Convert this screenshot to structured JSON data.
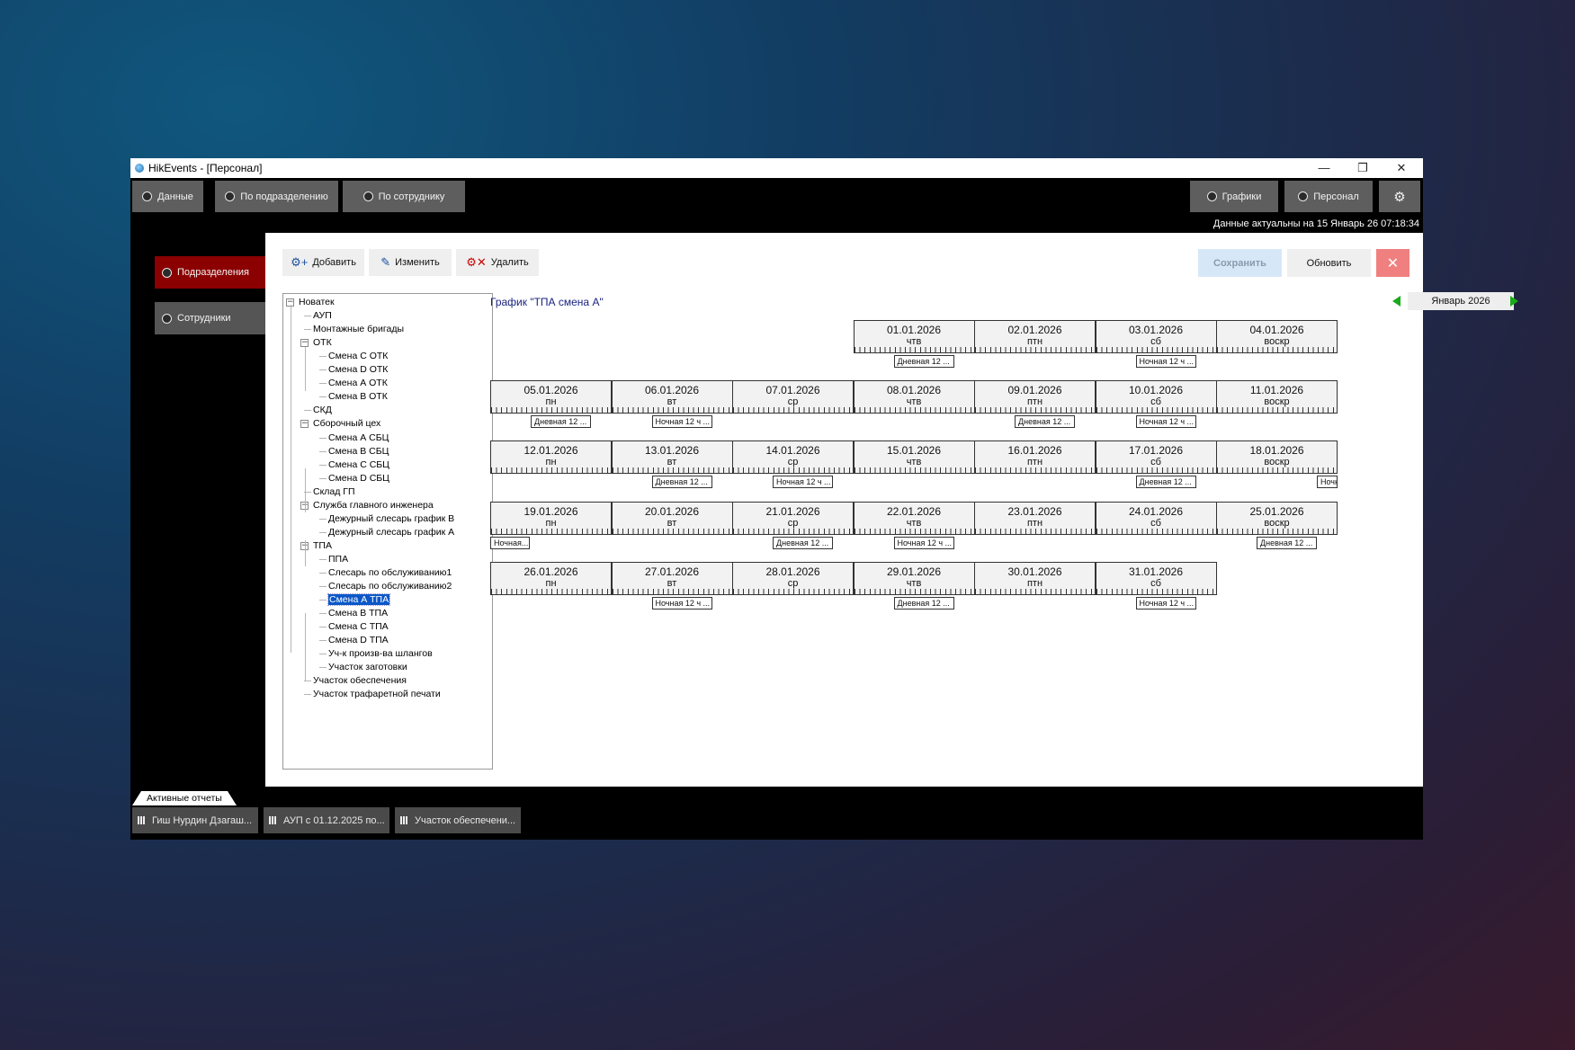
{
  "window": {
    "title": "HikEvents - [Персонал]",
    "minimize": "—",
    "maximize": "❐",
    "close": "✕"
  },
  "topnav": {
    "left": [
      "Данные",
      "По подразделению",
      "По сотруднику"
    ],
    "right": [
      "Графики",
      "Персонал"
    ],
    "settings_icon": "gear-icon"
  },
  "status": "Данные актуальны на 15 Январь 26 07:18:34",
  "sidebar": {
    "items": [
      "Подразделения",
      "Сотрудники"
    ],
    "active_color": "#8b0000"
  },
  "toolbar": {
    "add": "Добавить",
    "edit": "Изменить",
    "delete": "Удалить",
    "save": "Сохранить",
    "refresh": "Обновить"
  },
  "tree": [
    {
      "label": "Новатек",
      "level": 0,
      "exp": true
    },
    {
      "label": "АУП",
      "level": 1
    },
    {
      "label": "Монтажные бригады",
      "level": 1
    },
    {
      "label": "ОТК",
      "level": 1,
      "exp": true
    },
    {
      "label": "Смена С ОТК",
      "level": 2
    },
    {
      "label": "Смена D ОТК",
      "level": 2
    },
    {
      "label": "Смена А ОТК",
      "level": 2
    },
    {
      "label": "Смена В ОТК",
      "level": 2
    },
    {
      "label": "СКД",
      "level": 1
    },
    {
      "label": "Сборочный цех",
      "level": 1,
      "exp": true
    },
    {
      "label": "Смена А СБЦ",
      "level": 2
    },
    {
      "label": "Смена В СБЦ",
      "level": 2
    },
    {
      "label": "Смена С СБЦ",
      "level": 2
    },
    {
      "label": "Смена D СБЦ",
      "level": 2
    },
    {
      "label": "Склад ГП",
      "level": 1
    },
    {
      "label": "Служба главного инженера",
      "level": 1,
      "exp": true
    },
    {
      "label": "Дежурный слесарь график В",
      "level": 2
    },
    {
      "label": "Дежурный слесарь график А",
      "level": 2
    },
    {
      "label": "ТПА",
      "level": 1,
      "exp": true
    },
    {
      "label": "ППА",
      "level": 2
    },
    {
      "label": "Слесарь по обслуживанию1",
      "level": 2
    },
    {
      "label": "Слесарь по обслуживанию2",
      "level": 2
    },
    {
      "label": "Смена А ТПА",
      "level": 2,
      "selected": true
    },
    {
      "label": "Смена В ТПА",
      "level": 2
    },
    {
      "label": "Смена С ТПА",
      "level": 2
    },
    {
      "label": "Смена D ТПА",
      "level": 2
    },
    {
      "label": "Уч-к произв-ва шлангов",
      "level": 2
    },
    {
      "label": "Участок заготовки",
      "level": 2
    },
    {
      "label": "Участок обеспечения",
      "level": 1
    },
    {
      "label": "Участок трафаретной печати",
      "level": 1
    }
  ],
  "schedule": {
    "title": "График \"ТПА смена А\"",
    "month": "Январь 2026",
    "days": [
      {
        "date": "01.01.2026",
        "dow": "чтв",
        "shift": "Дневная 12 ..."
      },
      {
        "date": "02.01.2026",
        "dow": "птн",
        "shift": ""
      },
      {
        "date": "03.01.2026",
        "dow": "сб",
        "shift": "Ночная 12 ч ..."
      },
      {
        "date": "04.01.2026",
        "dow": "воскр",
        "shift": ""
      },
      {
        "date": "05.01.2026",
        "dow": "пн",
        "shift": "Дневная 12 ..."
      },
      {
        "date": "06.01.2026",
        "dow": "вт",
        "shift": "Ночная 12 ч ..."
      },
      {
        "date": "07.01.2026",
        "dow": "ср",
        "shift": ""
      },
      {
        "date": "08.01.2026",
        "dow": "чтв",
        "shift": ""
      },
      {
        "date": "09.01.2026",
        "dow": "птн",
        "shift": "Дневная 12 ..."
      },
      {
        "date": "10.01.2026",
        "dow": "сб",
        "shift": "Ночная 12 ч ..."
      },
      {
        "date": "11.01.2026",
        "dow": "воскр",
        "shift": ""
      },
      {
        "date": "12.01.2026",
        "dow": "пн",
        "shift": ""
      },
      {
        "date": "13.01.2026",
        "dow": "вт",
        "shift": "Дневная 12 ..."
      },
      {
        "date": "14.01.2026",
        "dow": "ср",
        "shift": "Ночная 12 ч ..."
      },
      {
        "date": "15.01.2026",
        "dow": "чтв",
        "shift": ""
      },
      {
        "date": "16.01.2026",
        "dow": "птн",
        "shift": ""
      },
      {
        "date": "17.01.2026",
        "dow": "сб",
        "shift": "Дневная 12 ..."
      },
      {
        "date": "18.01.2026",
        "dow": "воскр",
        "shift": "Ночн"
      },
      {
        "date": "19.01.2026",
        "dow": "пн",
        "shift": "Ночная..."
      },
      {
        "date": "20.01.2026",
        "dow": "вт",
        "shift": ""
      },
      {
        "date": "21.01.2026",
        "dow": "ср",
        "shift": "Дневная 12 ..."
      },
      {
        "date": "22.01.2026",
        "dow": "чтв",
        "shift": "Ночная 12 ч ..."
      },
      {
        "date": "23.01.2026",
        "dow": "птн",
        "shift": ""
      },
      {
        "date": "24.01.2026",
        "dow": "сб",
        "shift": ""
      },
      {
        "date": "25.01.2026",
        "dow": "воскр",
        "shift": "Дневная 12 ..."
      },
      {
        "date": "26.01.2026",
        "dow": "пн",
        "shift": ""
      },
      {
        "date": "27.01.2026",
        "dow": "вт",
        "shift": "Ночная 12 ч ..."
      },
      {
        "date": "28.01.2026",
        "dow": "ср",
        "shift": ""
      },
      {
        "date": "29.01.2026",
        "dow": "чтв",
        "shift": "Дневная 12 ..."
      },
      {
        "date": "30.01.2026",
        "dow": "птн",
        "shift": ""
      },
      {
        "date": "31.01.2026",
        "dow": "сб",
        "shift": "Ночная 12 ч ..."
      }
    ]
  },
  "reports": {
    "tab": "Активные отчеты",
    "items": [
      "Гиш Нурдин Дзагаш...",
      "АУП с 01.12.2025 по...",
      "Участок обеспечени..."
    ]
  }
}
